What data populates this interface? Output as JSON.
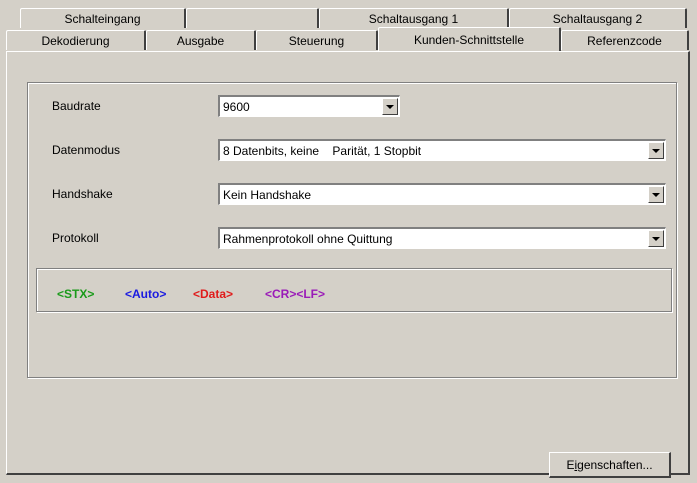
{
  "tabs": {
    "top": [
      {
        "label": "Schalteingang",
        "width": 166
      },
      {
        "label": "",
        "width": 133
      },
      {
        "label": "Schaltausgang 1",
        "width": 190
      },
      {
        "label": "Schaltausgang 2",
        "width": 178
      }
    ],
    "bottom": [
      {
        "label": "Dekodierung",
        "width": 140
      },
      {
        "label": "Ausgabe",
        "width": 110
      },
      {
        "label": "Steuerung",
        "width": 122
      },
      {
        "label": "Kunden-Schnittstelle",
        "width": 183
      },
      {
        "label": "Referenzcode",
        "width": 128
      }
    ],
    "active": "Kunden-Schnittstelle"
  },
  "form": {
    "baudrate_label": "Baudrate",
    "baudrate_value": "9600",
    "datenmodus_label": "Datenmodus",
    "datenmodus_value": "8 Datenbits, keine    Parität, 1 Stopbit",
    "handshake_label": "Handshake",
    "handshake_value": "Kein Handshake",
    "protokoll_label": "Protokoll",
    "protokoll_value": "Rahmenprotokoll ohne Quittung"
  },
  "preview": {
    "tokens": [
      {
        "text": "<STX>",
        "color": "#1a9a1a"
      },
      {
        "text": "<Auto>",
        "color": "#1a1ae0"
      },
      {
        "text": "<Data>",
        "color": "#e01a1a"
      },
      {
        "text": "<CR><LF>",
        "color": "#9a1ab8"
      }
    ]
  },
  "buttons": {
    "eigenschaften_prefix": "E",
    "eigenschaften_accel": "i",
    "eigenschaften_suffix": "genschaften..."
  },
  "colors": {
    "face": "#d4d0c8",
    "highlight": "#ffffff",
    "shadow": "#808080",
    "dark_shadow": "#404040"
  }
}
